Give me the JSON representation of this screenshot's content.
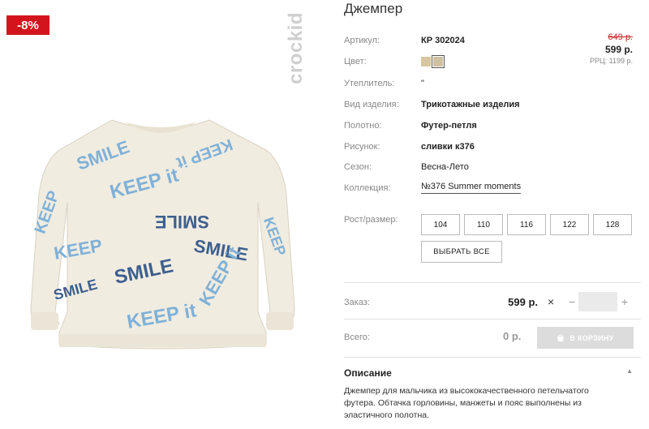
{
  "badge": {
    "discount": "-8%"
  },
  "brand": {
    "logo_text": "crockid"
  },
  "product": {
    "title": "Джемпер",
    "props": {
      "article_label": "Артикул:",
      "article_value": "КР 302024",
      "color_label": "Цвет:",
      "insulation_label": "Утеплитель:",
      "insulation_value": "\"",
      "type_label": "Вид изделия:",
      "type_value": "Трикотажные изделия",
      "fabric_label": "Полотно:",
      "fabric_value": "Футер-петля",
      "pattern_label": "Рисунок:",
      "pattern_value": "сливки к376",
      "season_label": "Сезон:",
      "season_value": "Весна-Лето",
      "collection_label": "Коллекция:",
      "collection_value": "№376 Summer moments"
    },
    "swatches": [
      "#d7c6a0",
      "#cfc0a1"
    ]
  },
  "price": {
    "old": "649 р.",
    "current": "599 р.",
    "rrp": "РРЦ: 1199 р."
  },
  "sizes": {
    "label": "Рост/размер:",
    "options": [
      "104",
      "110",
      "116",
      "122",
      "128"
    ],
    "select_all": "ВЫБРАТЬ ВСЕ"
  },
  "order": {
    "label": "Заказ:",
    "price": "599 р.",
    "times": "×",
    "minus": "−",
    "plus": "+",
    "quantity": ""
  },
  "total": {
    "label": "Всего:",
    "value": "0 р.",
    "cart_button": "В КОРЗИНУ"
  },
  "description": {
    "title": "Описание",
    "caret": "▲",
    "text": "Джемпер для мальчика из высококачественного петельчатого футера. Обтачка горловины, манжеты и пояс выполнены из эластичного полотна."
  }
}
